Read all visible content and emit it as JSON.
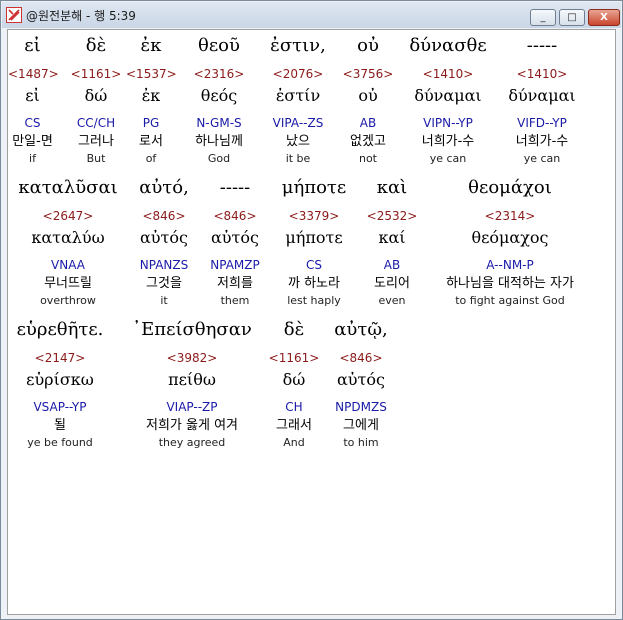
{
  "window": {
    "title": "@원전분해 - 행 5:39",
    "minimize": "_",
    "maximize": "□",
    "close": "X"
  },
  "lines": [
    {
      "words": [
        {
          "greek": "εἰ",
          "strong": "<1487>",
          "lemma": "εἰ",
          "parse": "CS",
          "korean": "만일-면",
          "english": "if"
        },
        {
          "greek": "δὲ",
          "strong": "<1161>",
          "lemma": "δώ",
          "parse": "CC/CH",
          "korean": "그러나",
          "english": "But"
        },
        {
          "greek": "ἐκ",
          "strong": "<1537>",
          "lemma": "ἐκ",
          "parse": "PG",
          "korean": "로서",
          "english": "of"
        },
        {
          "greek": "θεοῦ",
          "strong": "<2316>",
          "lemma": "θεός",
          "parse": "N-GM-S",
          "korean": "하나님께",
          "english": "God"
        },
        {
          "greek": "ἐστιν,",
          "strong": "<2076>",
          "lemma": "ἐστίν",
          "parse": "VIPA--ZS",
          "korean": "났으",
          "english": "it be"
        },
        {
          "greek": "οὐ",
          "strong": "<3756>",
          "lemma": "οὐ",
          "parse": "AB",
          "korean": "없겠고",
          "english": "not"
        },
        {
          "greek": "δύνασθε",
          "strong": "<1410>",
          "lemma": "δύναμαι",
          "parse": "VIPN--YP",
          "korean": "너희가-수",
          "english": "ye can"
        },
        {
          "greek": "-----",
          "strong": "<1410>",
          "lemma": "δύναμαι",
          "parse": "VIFD--YP",
          "korean": "너희가-수",
          "english": "ye can"
        }
      ]
    },
    {
      "words": [
        {
          "greek": "καταλῦσαι",
          "strong": "<2647>",
          "lemma": "καταλύω",
          "parse": "VNAA",
          "korean": "무너뜨릴",
          "english": "overthrow"
        },
        {
          "greek": "αὐτό,",
          "strong": "<846>",
          "lemma": "αὐτός",
          "parse": "NPANZS",
          "korean": "그것을",
          "english": "it"
        },
        {
          "greek": "-----",
          "strong": "<846>",
          "lemma": "αὐτός",
          "parse": "NPAMZP",
          "korean": "저희를",
          "english": "them"
        },
        {
          "greek": "μήποτε",
          "strong": "<3379>",
          "lemma": "μήποτε",
          "parse": "CS",
          "korean": "까 하노라",
          "english": "lest haply"
        },
        {
          "greek": "καὶ",
          "strong": "<2532>",
          "lemma": "καί",
          "parse": "AB",
          "korean": "도리어",
          "english": "even"
        },
        {
          "greek": "θεομάχοι",
          "strong": "<2314>",
          "lemma": "θεόμαχος",
          "parse": "A--NM-P",
          "korean": "하나님을 대적하는 자가",
          "english": "to fight against God"
        }
      ]
    },
    {
      "words": [
        {
          "greek": "εὑρεθῆτε.",
          "strong": "<2147>",
          "lemma": "εὑρίσκω",
          "parse": "VSAP--YP",
          "korean": "될",
          "english": "ye be found"
        },
        {
          "greek": "᾿Επείσθησαν",
          "strong": "<3982>",
          "lemma": "πείθω",
          "parse": "VIAP--ZP",
          "korean": "저희가 옳게 여겨",
          "english": "they agreed"
        },
        {
          "greek": "δὲ",
          "strong": "<1161>",
          "lemma": "δώ",
          "parse": "CH",
          "korean": "그래서",
          "english": "And"
        },
        {
          "greek": "αὐτῷ,",
          "strong": "<846>",
          "lemma": "αὐτός",
          "parse": "NPDMZS",
          "korean": "그에게",
          "english": "to him"
        }
      ]
    }
  ]
}
